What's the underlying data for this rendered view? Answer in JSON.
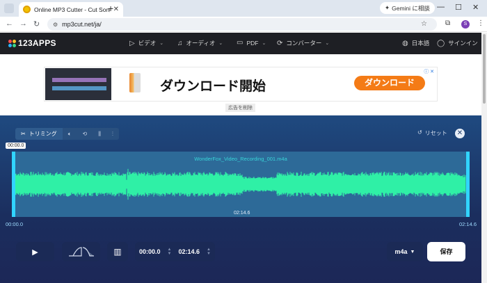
{
  "browser": {
    "tab_title": "Online MP3 Cutter - Cut Songs,",
    "gemini_label": "Gemini に相談",
    "url": "mp3cut.net/ja/",
    "avatar_letter": "S"
  },
  "site": {
    "logo": "123APPS",
    "nav": [
      {
        "label": "ビデオ"
      },
      {
        "label": "オーディオ"
      },
      {
        "label": "PDF"
      },
      {
        "label": "コンバーター"
      }
    ],
    "language": "日本語",
    "signin": "サインイン"
  },
  "ad": {
    "headline": "ダウンロード開始",
    "button": "ダウンロード",
    "remove_label": "広告を削除"
  },
  "editor": {
    "tools": {
      "trim": "トリミング"
    },
    "reset": "リセット",
    "filename": "WonderFox_Video_Recording_001.m4a",
    "selection_start_badge": "00:00.0",
    "left_time": "00:00.0",
    "right_time": "02:14.6",
    "mid_time": "02:14.6",
    "start_time": "00:00.0",
    "end_time": "02:14.6",
    "format": "m4a",
    "save": "保存",
    "accent_color": "#2ff0a6"
  }
}
